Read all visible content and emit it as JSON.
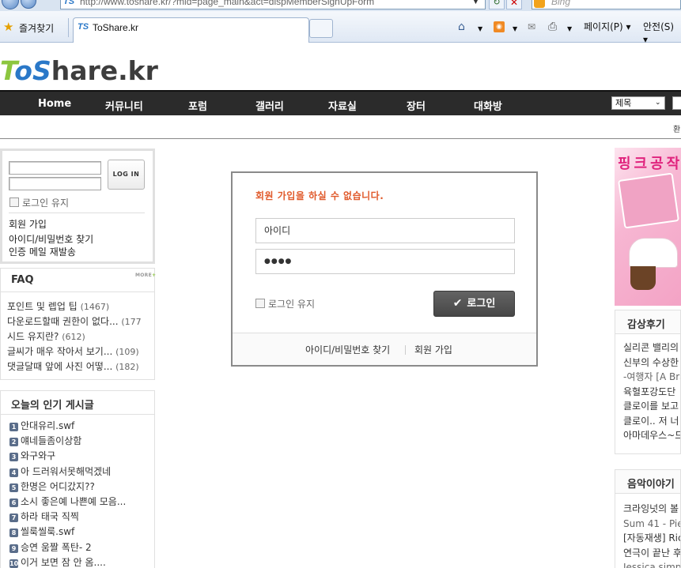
{
  "browser": {
    "url": "http://www.toshare.kr/?mid=page_main&act=dispMemberSignUpForm",
    "search_placeholder": "Bing",
    "favorites_label": "즐겨찾기",
    "tab_title": "ToShare.kr",
    "tab_favicon": "TS",
    "toolbar": {
      "page_label": "페이지(P) ▾",
      "safety_label": "안전(S) ▾"
    }
  },
  "site": {
    "logo": {
      "t": "T",
      "o": "o",
      "s": "S",
      "rest": "hare.kr"
    },
    "nav": [
      "Home",
      "커뮤니티",
      "포럼",
      "갤러리",
      "자료실",
      "장터",
      "대화방"
    ],
    "search_select": "제목",
    "subbar_text": "환"
  },
  "login_box": {
    "login_button": "LOG IN",
    "remember_label": "로그인 유지",
    "links": [
      "회원 가입",
      "아이디/비밀번호 찾기",
      "인증 메일 재발송"
    ]
  },
  "faq": {
    "title": "FAQ",
    "more_label": "MORE",
    "items": [
      {
        "text": "포인트 및 렙업 팁",
        "count": "(1467)"
      },
      {
        "text": "다운로드할때 권한이 없다...",
        "count": "(177"
      },
      {
        "text": "시드 유지란?",
        "count": "(612)"
      },
      {
        "text": "글씨가 매우 작아서 보기...",
        "count": "(109)"
      },
      {
        "text": "댓글달때 앞에 사진 어떻...",
        "count": "(182)"
      }
    ]
  },
  "popular": {
    "title": "오늘의 인기 게시글",
    "items": [
      {
        "num": "1",
        "text": "안대유리.swf"
      },
      {
        "num": "2",
        "text": "얘네들좀이상함"
      },
      {
        "num": "3",
        "text": "와구와구"
      },
      {
        "num": "4",
        "text": "아 드러워서못해먹겠네"
      },
      {
        "num": "5",
        "text": "한명은 어디갔지??"
      },
      {
        "num": "6",
        "text": "소시 좋은예 나쁜예 모음..."
      },
      {
        "num": "7",
        "text": "하라 태국 직찍"
      },
      {
        "num": "8",
        "text": "씰룩씰룩.swf"
      },
      {
        "num": "9",
        "text": "승연 움짤 폭탄- 2"
      },
      {
        "num": "10",
        "text": "이거 보면 잠 안 옴...."
      }
    ]
  },
  "login_card": {
    "message": "회원 가입을 하실 수 없습니다.",
    "id_value": "아이디",
    "password_value": "●●●●",
    "remember_label": "로그인 유지",
    "login_button": "로그인",
    "login_button_icon": "✔",
    "find_link": "아이디/비밀번호 찾기",
    "join_link": "회원 가입"
  },
  "right": {
    "banner_text": "핑크공작",
    "review": {
      "title": "감상후기",
      "items": [
        "실리콘 밸리의",
        "신부의 수상한",
        "-여행자 [A Bra",
        "육혈포강도단",
        "클로이를 보고",
        "클로이.. 저 너",
        "아마데우스~드"
      ]
    },
    "music": {
      "title": "음악이야기",
      "items": [
        "크라잉넛의 볼",
        "Sum 41 - Piec",
        "[자동재생] Ric",
        "연극이 끝난 후",
        "Jessica simp"
      ]
    }
  },
  "colors": {
    "nav_bg": "#2b2b2b",
    "alert_text": "#e0592a",
    "logo_green": "#8cc63f",
    "logo_blue": "#2a78c8",
    "button_dark": "#4f4f4f"
  }
}
